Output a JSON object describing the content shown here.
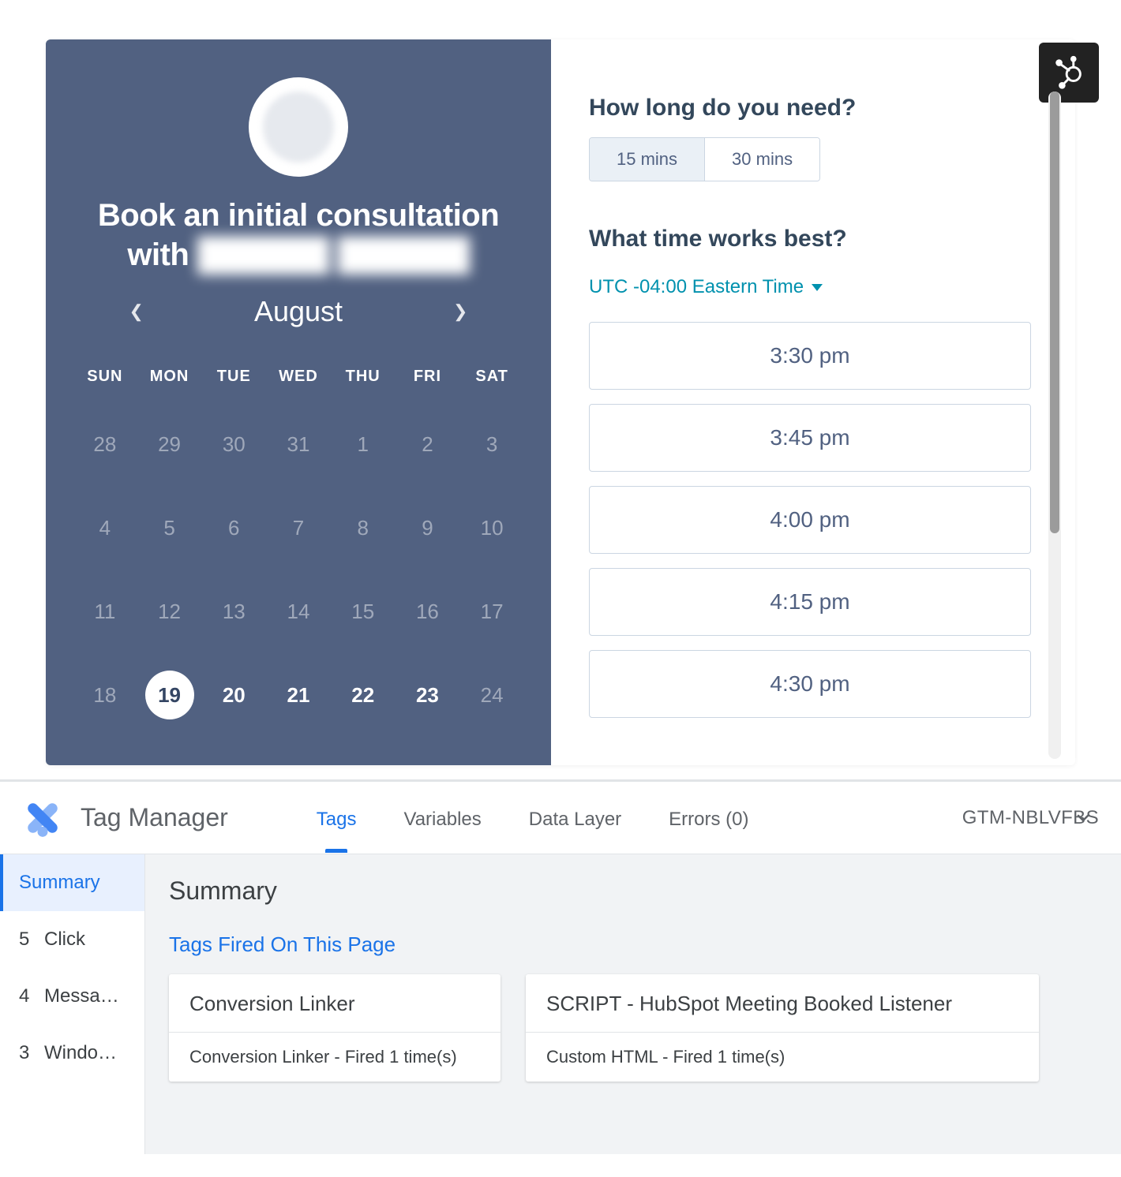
{
  "booking": {
    "heading_prefix": "Book an initial consultation with ",
    "heading_blurred": "██████ ██████",
    "month": "August",
    "dow": [
      "SUN",
      "MON",
      "TUE",
      "WED",
      "THU",
      "FRI",
      "SAT"
    ],
    "weeks": [
      [
        {
          "n": "28",
          "s": "m"
        },
        {
          "n": "29",
          "s": "m"
        },
        {
          "n": "30",
          "s": "m"
        },
        {
          "n": "31",
          "s": "m"
        },
        {
          "n": "1",
          "s": "m"
        },
        {
          "n": "2",
          "s": "m"
        },
        {
          "n": "3",
          "s": "m"
        }
      ],
      [
        {
          "n": "4",
          "s": "m"
        },
        {
          "n": "5",
          "s": "m"
        },
        {
          "n": "6",
          "s": "m"
        },
        {
          "n": "7",
          "s": "m"
        },
        {
          "n": "8",
          "s": "m"
        },
        {
          "n": "9",
          "s": "m"
        },
        {
          "n": "10",
          "s": "m"
        }
      ],
      [
        {
          "n": "11",
          "s": "m"
        },
        {
          "n": "12",
          "s": "m"
        },
        {
          "n": "13",
          "s": "m"
        },
        {
          "n": "14",
          "s": "m"
        },
        {
          "n": "15",
          "s": "m"
        },
        {
          "n": "16",
          "s": "m"
        },
        {
          "n": "17",
          "s": "m"
        }
      ],
      [
        {
          "n": "18",
          "s": "m"
        },
        {
          "n": "19",
          "s": "sel"
        },
        {
          "n": "20",
          "s": "b"
        },
        {
          "n": "21",
          "s": "b"
        },
        {
          "n": "22",
          "s": "b"
        },
        {
          "n": "23",
          "s": "b"
        },
        {
          "n": "24",
          "s": "m"
        }
      ]
    ],
    "duration_label": "How long do you need?",
    "durations": [
      {
        "label": "15 mins",
        "selected": true
      },
      {
        "label": "30 mins",
        "selected": false
      }
    ],
    "time_label": "What time works best?",
    "timezone": "UTC -04:00 Eastern Time",
    "slots": [
      "3:30 pm",
      "3:45 pm",
      "4:00 pm",
      "4:15 pm",
      "4:30 pm"
    ]
  },
  "gtm": {
    "title": "Tag Manager",
    "tabs": [
      "Tags",
      "Variables",
      "Data Layer",
      "Errors (0)"
    ],
    "active_tab": 0,
    "container_overlay": "GTM-NBLVFBS",
    "sidebar": [
      {
        "idx": "",
        "label": "Summary",
        "active": true
      },
      {
        "idx": "5",
        "label": "Click",
        "active": false
      },
      {
        "idx": "4",
        "label": "Messa…",
        "active": false
      },
      {
        "idx": "3",
        "label": "Windo…",
        "active": false
      }
    ],
    "content_heading": "Summary",
    "fired_label": "Tags Fired On This Page",
    "tags": [
      {
        "name": "Conversion Linker",
        "meta": "Conversion Linker - Fired 1 time(s)",
        "size": "small"
      },
      {
        "name": "SCRIPT - HubSpot Meeting Booked Listener",
        "meta": "Custom HTML - Fired 1 time(s)",
        "size": "big"
      }
    ]
  }
}
